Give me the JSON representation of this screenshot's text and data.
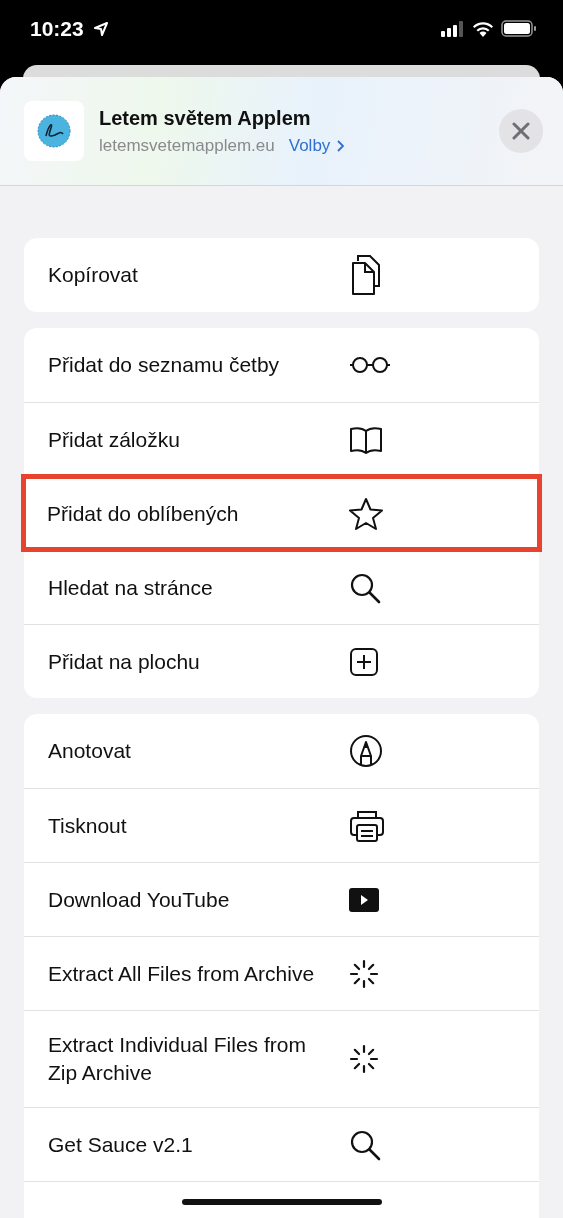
{
  "status_bar": {
    "time": "10:23"
  },
  "header": {
    "title": "Letem světem Applem",
    "url": "letemsvetemapplem.eu",
    "options_link": "Volby"
  },
  "groups": [
    {
      "rows": [
        {
          "label": "Kopírovat",
          "kind": "copy",
          "highlighted": false
        }
      ]
    },
    {
      "rows": [
        {
          "label": "Přidat do seznamu četby",
          "kind": "glasses",
          "highlighted": false
        },
        {
          "label": "Přidat záložku",
          "kind": "book",
          "highlighted": false
        },
        {
          "label": "Přidat do oblíbených",
          "kind": "star",
          "highlighted": true
        },
        {
          "label": "Hledat na stránce",
          "kind": "search",
          "highlighted": false
        },
        {
          "label": "Přidat na plochu",
          "kind": "plus-square",
          "highlighted": false
        }
      ]
    },
    {
      "rows": [
        {
          "label": "Anotovat",
          "kind": "markup",
          "highlighted": false
        },
        {
          "label": "Tisknout",
          "kind": "printer",
          "highlighted": false
        },
        {
          "label": "Download YouTube",
          "kind": "play",
          "highlighted": false
        },
        {
          "label": "Extract All Files from Archive",
          "kind": "spinner",
          "highlighted": false
        },
        {
          "label": "Extract Individual Files from Zip Archive",
          "kind": "spinner",
          "highlighted": false
        },
        {
          "label": "Get Sauce v2.1",
          "kind": "search",
          "highlighted": false
        }
      ]
    }
  ]
}
